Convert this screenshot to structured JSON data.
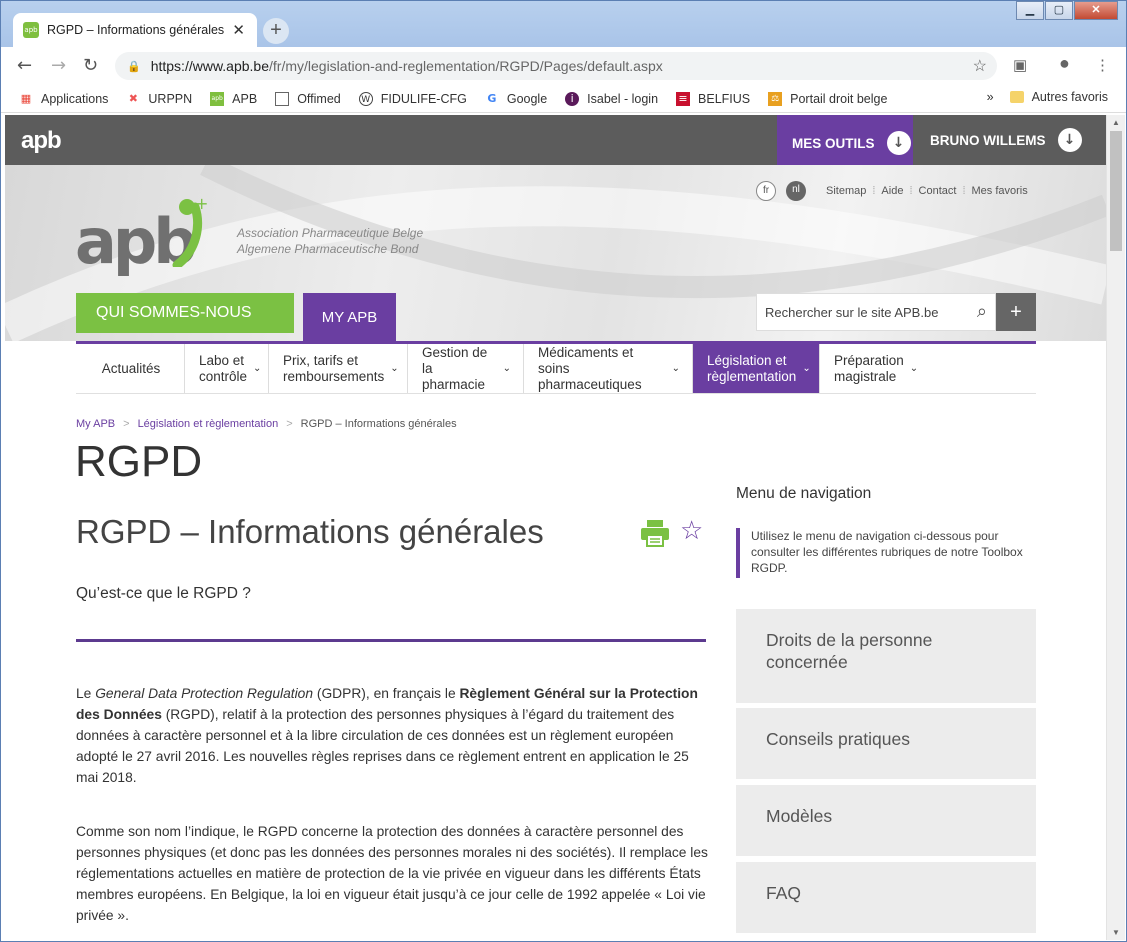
{
  "browser": {
    "tab_title": "RGPD – Informations générales",
    "tab_favicon_text": "apb",
    "url_host": "https://www.apb.be",
    "url_path": "/fr/my/legislation-and-reglementation/RGPD/Pages/default.aspx",
    "bookmarks": [
      {
        "label": "Applications",
        "icon": "apps-grid-icon"
      },
      {
        "label": "URPPN",
        "icon": "urppn-icon"
      },
      {
        "label": "APB",
        "icon": "apb-icon"
      },
      {
        "label": "Offimed",
        "icon": "page-icon"
      },
      {
        "label": "FIDULIFE-CFG",
        "icon": "wordpress-icon"
      },
      {
        "label": "Google",
        "icon": "google-icon"
      },
      {
        "label": "Isabel - login",
        "icon": "isabel-icon"
      },
      {
        "label": "BELFIUS",
        "icon": "belfius-icon"
      },
      {
        "label": "Portail droit belge",
        "icon": "scales-icon"
      }
    ],
    "bookmarks_more": "»",
    "other_bookmarks": "Autres favoris"
  },
  "site": {
    "mini_logo": "apb",
    "mes_outils": "MES OUTILS",
    "user_name": "BRUNO WILLEMS",
    "lang_fr": "fr",
    "lang_nl": "nl",
    "util_links": [
      "Sitemap",
      "Aide",
      "Contact",
      "Mes favoris"
    ],
    "logo_text": "apb",
    "tagline_1": "Association Pharmaceutique Belge",
    "tagline_2": "Algemene Pharmaceutische Bond",
    "btn_qui": "QUI SOMMES-NOUS",
    "btn_myapb": "MY APB",
    "search_placeholder": "Rechercher sur le site APB.be",
    "menu": [
      {
        "line1": "Actualités",
        "line2": ""
      },
      {
        "line1": "Labo et",
        "line2": "contrôle"
      },
      {
        "line1": "Prix, tarifs et",
        "line2": "remboursements"
      },
      {
        "line1": "Gestion de la",
        "line2": "pharmacie"
      },
      {
        "line1": "Médicaments et soins",
        "line2": "pharmaceutiques"
      },
      {
        "line1": "Législation et",
        "line2": "règlementation"
      },
      {
        "line1": "Préparation",
        "line2": "magistrale"
      }
    ]
  },
  "content": {
    "breadcrumb": [
      "My APB",
      "Législation et règlementation",
      "RGPD – Informations générales"
    ],
    "h1": "RGPD",
    "h2": "RGPD – Informations générales",
    "h3": "Qu’est-ce que le RGPD ?",
    "p1_a": "Le ",
    "p1_b": "General Data Protection Regulation",
    "p1_c": " (GDPR), en français le ",
    "p1_d": "Règlement Général sur la Protection des Données",
    "p1_e": " (RGPD), relatif à la protection des personnes physiques à l’égard du traitement des données à caractère personnel et à la libre circulation de ces données est un règlement européen adopté le 27 avril 2016. Les nouvelles règles reprises dans ce règlement entrent en application le 25 mai 2018.",
    "p2": "Comme son nom l’indique, le RGPD concerne la protection des données à caractère personnel des personnes physiques (et donc pas les données des personnes morales ni des sociétés). Il remplace les réglementations actuelles en matière de protection de la vie privée en vigueur dans les différents États membres européens. En Belgique, la loi en vigueur était jusqu’à ce jour celle de 1992 appelée « Loi vie privée ».",
    "side_title": "Menu de navigation",
    "side_note": "Utilisez le menu de navigation ci-dessous pour consulter les différentes rubriques de notre Toolbox RGDP.",
    "side_items": [
      "Droits de la personne concernée",
      "Conseils pratiques",
      "Modèles",
      "FAQ"
    ]
  },
  "colors": {
    "purple": "#6a3ea1",
    "green": "#7bc143",
    "dark": "#5c5c5c"
  }
}
